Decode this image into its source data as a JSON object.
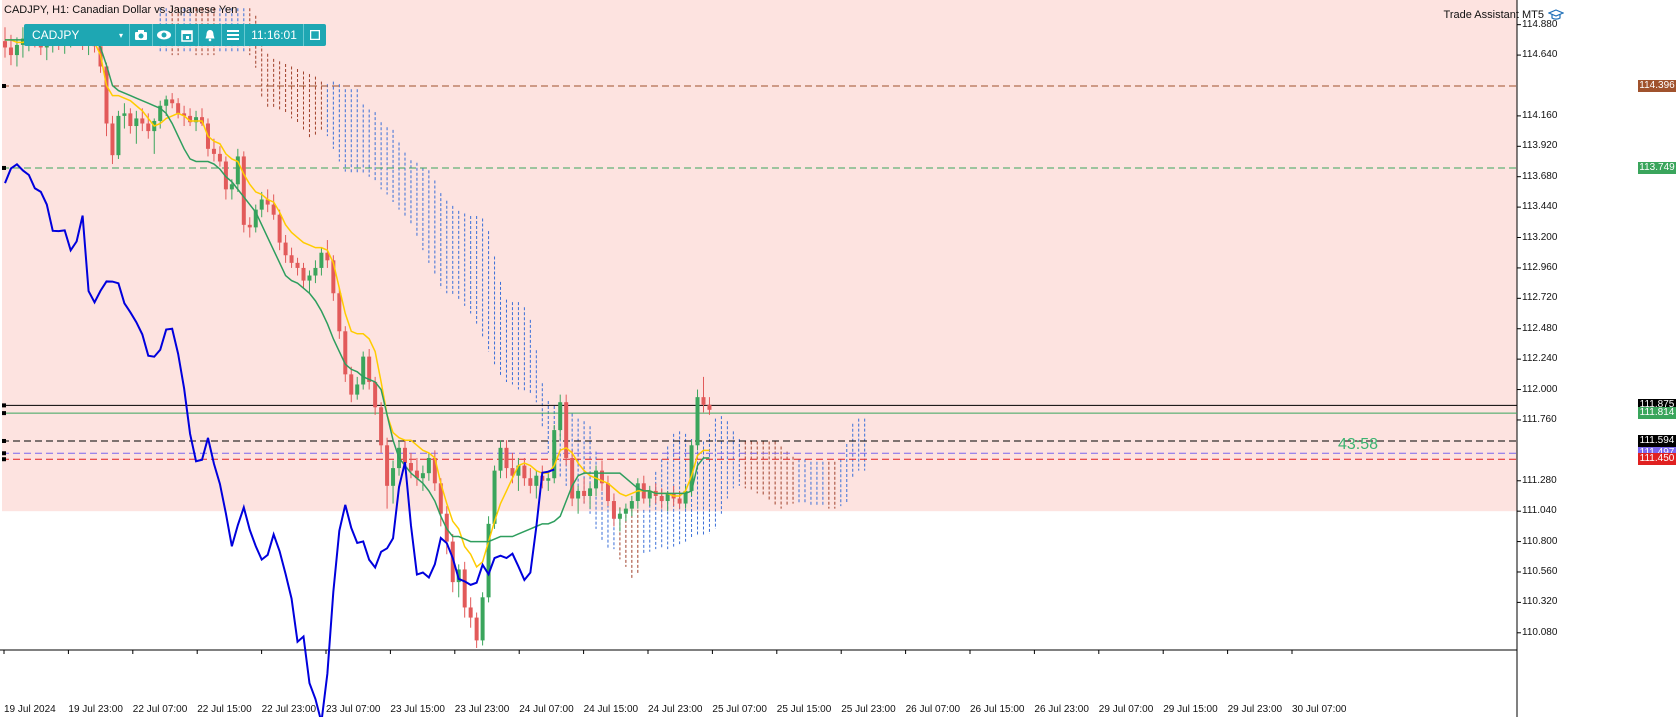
{
  "title": "CADJPY, H1:  Canadian Dollar vs Japanese Yen",
  "toolbar": {
    "symbol": "CADJPY",
    "time": "11:16:01",
    "icons": [
      "camera-icon",
      "eye-icon",
      "calendar-icon",
      "bell-icon",
      "menu-icon",
      "minimize-icon"
    ]
  },
  "assistant_label": "Trade Assistant MT5",
  "countdown": "43:58",
  "price_axis": [
    "114.880",
    "114.640",
    "114.160",
    "113.920",
    "113.680",
    "113.440",
    "113.200",
    "112.960",
    "112.720",
    "112.480",
    "112.240",
    "112.000",
    "111.760",
    "111.280",
    "111.040",
    "110.800",
    "110.560",
    "110.320",
    "110.080"
  ],
  "price_levels": [
    {
      "value": "114.396",
      "color": "#a0522d"
    },
    {
      "value": "113.749",
      "color": "#3aa55c"
    },
    {
      "value": "111.875",
      "color": "#000000"
    },
    {
      "value": "111.814",
      "color": "#3aa55c"
    },
    {
      "value": "111.594",
      "color": "#000000"
    },
    {
      "value": "111.497",
      "color": "#7b68ee"
    },
    {
      "value": "111.450",
      "color": "#e02020"
    }
  ],
  "time_axis": [
    "19 Jul 2024",
    "19 Jul 23:00",
    "22 Jul 07:00",
    "22 Jul 15:00",
    "22 Jul 23:00",
    "23 Jul 07:00",
    "23 Jul 15:00",
    "23 Jul 23:00",
    "24 Jul 07:00",
    "24 Jul 15:00",
    "24 Jul 23:00",
    "25 Jul 07:00",
    "25 Jul 15:00",
    "25 Jul 23:00",
    "26 Jul 07:00",
    "26 Jul 15:00",
    "26 Jul 23:00",
    "29 Jul 07:00",
    "29 Jul 15:00",
    "29 Jul 23:00",
    "30 Jul 07:00"
  ],
  "colors": {
    "bull": "#3aa55c",
    "bear": "#e25a5a",
    "chikou": "#0000dd",
    "tenkan": "#ffcc00",
    "kijun": "#2e9e5e",
    "zone": "#fde3e0"
  },
  "chart_data": {
    "type": "candlestick",
    "symbol": "CADJPY",
    "timeframe": "H1",
    "ylim": [
      109.96,
      114.98
    ],
    "grid": false,
    "candles_ohlc": [
      [
        114.75,
        114.86,
        114.62,
        114.7
      ],
      [
        114.7,
        114.8,
        114.56,
        114.64
      ],
      [
        114.64,
        114.78,
        114.55,
        114.72
      ],
      [
        114.72,
        114.86,
        114.62,
        114.77
      ],
      [
        114.77,
        114.86,
        114.67,
        114.79
      ],
      [
        114.79,
        114.86,
        114.7,
        114.75
      ],
      [
        114.75,
        114.82,
        114.64,
        114.7
      ],
      [
        114.7,
        114.8,
        114.6,
        114.74
      ],
      [
        114.74,
        114.84,
        114.66,
        114.77
      ],
      [
        114.77,
        114.84,
        114.68,
        114.73
      ],
      [
        114.73,
        114.81,
        114.65,
        114.77
      ],
      [
        114.77,
        114.85,
        114.7,
        114.8
      ],
      [
        114.8,
        114.86,
        114.72,
        114.76
      ],
      [
        114.76,
        114.82,
        114.68,
        114.72
      ],
      [
        114.72,
        114.8,
        114.64,
        114.75
      ],
      [
        114.75,
        114.82,
        114.66,
        114.71
      ],
      [
        114.71,
        114.76,
        114.5,
        114.55
      ],
      [
        114.55,
        114.58,
        114.0,
        114.1
      ],
      [
        114.1,
        114.16,
        113.78,
        113.85
      ],
      [
        113.85,
        114.2,
        113.82,
        114.16
      ],
      [
        114.16,
        114.26,
        114.06,
        114.18
      ],
      [
        114.18,
        114.22,
        114.02,
        114.08
      ],
      [
        114.08,
        114.2,
        113.94,
        114.14
      ],
      [
        114.14,
        114.22,
        114.04,
        114.1
      ],
      [
        114.1,
        114.18,
        113.98,
        114.04
      ],
      [
        114.04,
        114.14,
        113.86,
        114.12
      ],
      [
        114.12,
        114.28,
        114.06,
        114.24
      ],
      [
        114.24,
        114.32,
        114.16,
        114.29
      ],
      [
        114.29,
        114.34,
        114.22,
        114.26
      ],
      [
        114.26,
        114.3,
        114.14,
        114.18
      ],
      [
        114.18,
        114.24,
        114.08,
        114.16
      ],
      [
        114.16,
        114.22,
        114.08,
        114.11
      ],
      [
        114.11,
        114.2,
        114.04,
        114.15
      ],
      [
        114.15,
        114.22,
        114.08,
        114.1
      ],
      [
        114.1,
        114.14,
        113.84,
        113.9
      ],
      [
        113.9,
        113.98,
        113.8,
        113.86
      ],
      [
        113.86,
        113.92,
        113.76,
        113.8
      ],
      [
        113.8,
        113.84,
        113.5,
        113.58
      ],
      [
        113.58,
        113.66,
        113.5,
        113.62
      ],
      [
        113.62,
        113.9,
        113.56,
        113.84
      ],
      [
        113.84,
        113.88,
        113.24,
        113.3
      ],
      [
        113.3,
        113.36,
        113.2,
        113.28
      ],
      [
        113.28,
        113.46,
        113.24,
        113.42
      ],
      [
        113.42,
        113.56,
        113.36,
        113.5
      ],
      [
        113.5,
        113.58,
        113.4,
        113.46
      ],
      [
        113.46,
        113.54,
        113.34,
        113.38
      ],
      [
        113.38,
        113.42,
        113.1,
        113.16
      ],
      [
        113.16,
        113.22,
        113.0,
        113.06
      ],
      [
        113.06,
        113.12,
        112.96,
        113.0
      ],
      [
        113.0,
        113.04,
        112.9,
        112.96
      ],
      [
        112.96,
        113.0,
        112.8,
        112.86
      ],
      [
        112.86,
        112.94,
        112.76,
        112.9
      ],
      [
        112.9,
        113.02,
        112.84,
        112.96
      ],
      [
        112.96,
        113.12,
        112.9,
        113.08
      ],
      [
        113.08,
        113.18,
        112.96,
        113.02
      ],
      [
        113.02,
        113.06,
        112.7,
        112.76
      ],
      [
        112.76,
        112.8,
        112.4,
        112.46
      ],
      [
        112.46,
        112.5,
        112.06,
        112.12
      ],
      [
        112.12,
        112.18,
        111.9,
        111.96
      ],
      [
        111.96,
        112.1,
        111.92,
        112.04
      ],
      [
        112.04,
        112.3,
        112.0,
        112.26
      ],
      [
        112.26,
        112.32,
        112.0,
        112.06
      ],
      [
        112.06,
        112.1,
        111.8,
        111.86
      ],
      [
        111.86,
        111.9,
        111.5,
        111.56
      ],
      [
        111.56,
        111.62,
        111.06,
        111.24
      ],
      [
        111.24,
        111.44,
        111.1,
        111.38
      ],
      [
        111.38,
        111.6,
        111.32,
        111.54
      ],
      [
        111.54,
        111.6,
        111.38,
        111.42
      ],
      [
        111.42,
        111.5,
        111.3,
        111.36
      ],
      [
        111.36,
        111.46,
        111.24,
        111.3
      ],
      [
        111.3,
        111.4,
        111.2,
        111.34
      ],
      [
        111.34,
        111.5,
        111.28,
        111.46
      ],
      [
        111.46,
        111.52,
        111.2,
        111.26
      ],
      [
        111.26,
        111.3,
        110.92,
        111.02
      ],
      [
        111.02,
        111.08,
        110.7,
        110.8
      ],
      [
        110.8,
        110.86,
        110.4,
        110.48
      ],
      [
        110.48,
        110.62,
        110.36,
        110.58
      ],
      [
        110.58,
        110.64,
        110.2,
        110.28
      ],
      [
        110.28,
        110.36,
        110.12,
        110.2
      ],
      [
        110.2,
        110.24,
        109.96,
        110.02
      ],
      [
        110.02,
        110.4,
        109.98,
        110.36
      ],
      [
        110.36,
        111.0,
        110.32,
        110.94
      ],
      [
        110.94,
        111.4,
        110.9,
        111.36
      ],
      [
        111.36,
        111.6,
        111.3,
        111.54
      ],
      [
        111.54,
        111.6,
        111.3,
        111.38
      ],
      [
        111.38,
        111.5,
        111.26,
        111.32
      ],
      [
        111.32,
        111.46,
        111.2,
        111.4
      ],
      [
        111.4,
        111.46,
        111.24,
        111.3
      ],
      [
        111.3,
        111.38,
        111.18,
        111.24
      ],
      [
        111.24,
        111.36,
        111.14,
        111.32
      ],
      [
        111.32,
        111.4,
        111.22,
        111.28
      ],
      [
        111.28,
        111.36,
        111.2,
        111.3
      ],
      [
        111.3,
        111.72,
        111.26,
        111.68
      ],
      [
        111.68,
        111.96,
        111.6,
        111.9
      ],
      [
        111.9,
        111.96,
        111.4,
        111.46
      ],
      [
        111.46,
        111.52,
        111.08,
        111.14
      ],
      [
        111.14,
        111.24,
        111.02,
        111.2
      ],
      [
        111.2,
        111.3,
        111.1,
        111.16
      ],
      [
        111.16,
        111.26,
        111.06,
        111.22
      ],
      [
        111.22,
        111.4,
        111.16,
        111.36
      ],
      [
        111.36,
        111.44,
        111.2,
        111.26
      ],
      [
        111.26,
        111.32,
        111.08,
        111.12
      ],
      [
        111.12,
        111.18,
        110.92,
        110.98
      ],
      [
        110.98,
        111.06,
        110.88,
        111.02
      ],
      [
        111.02,
        111.1,
        110.96,
        111.06
      ],
      [
        111.06,
        111.16,
        111.0,
        111.12
      ],
      [
        111.12,
        111.3,
        111.06,
        111.26
      ],
      [
        111.26,
        111.32,
        111.1,
        111.14
      ],
      [
        111.14,
        111.24,
        111.08,
        111.2
      ],
      [
        111.2,
        111.26,
        111.1,
        111.16
      ],
      [
        111.16,
        111.22,
        111.06,
        111.12
      ],
      [
        111.12,
        111.2,
        111.04,
        111.18
      ],
      [
        111.18,
        111.24,
        111.08,
        111.14
      ],
      [
        111.14,
        111.2,
        111.06,
        111.1
      ],
      [
        111.1,
        111.24,
        111.06,
        111.2
      ],
      [
        111.2,
        111.6,
        111.16,
        111.56
      ],
      [
        111.56,
        112.0,
        111.52,
        111.94
      ],
      [
        111.94,
        112.1,
        111.82,
        111.88
      ],
      [
        111.88,
        111.94,
        111.8,
        111.84
      ]
    ],
    "chikou_x_index_offset": -26,
    "tenkan": [
      114.76,
      114.76,
      114.74,
      114.74,
      114.76,
      114.76,
      114.74,
      114.74,
      114.74,
      114.74,
      114.76,
      114.76,
      114.76,
      114.76,
      114.76,
      114.74,
      114.64,
      114.4,
      114.32,
      114.32,
      114.3,
      114.28,
      114.24,
      114.2,
      114.14,
      114.08,
      114.1,
      114.14,
      114.16,
      114.18,
      114.16,
      114.12,
      114.12,
      114.12,
      114.0,
      113.96,
      113.94,
      113.86,
      113.82,
      113.8,
      113.7,
      113.62,
      113.56,
      113.54,
      113.5,
      113.48,
      113.4,
      113.3,
      113.24,
      113.2,
      113.16,
      113.14,
      113.12,
      113.12,
      113.1,
      113.0,
      112.8,
      112.6,
      112.46,
      112.44,
      112.44,
      112.4,
      112.3,
      112.06,
      111.8,
      111.66,
      111.62,
      111.6,
      111.6,
      111.56,
      111.52,
      111.5,
      111.46,
      111.26,
      111.1,
      110.96,
      110.9,
      110.76,
      110.7,
      110.6,
      110.64,
      110.8,
      110.96,
      111.1,
      111.2,
      111.3,
      111.4,
      111.42,
      111.4,
      111.36,
      111.34,
      111.34,
      111.4,
      111.52,
      111.54,
      111.5,
      111.42,
      111.36,
      111.32,
      111.3,
      111.28,
      111.26,
      111.22,
      111.18,
      111.16,
      111.18,
      111.2,
      111.2,
      111.2,
      111.18,
      111.18,
      111.18,
      111.16,
      111.16,
      111.2,
      111.32,
      111.48,
      111.52,
      111.52
    ],
    "kijun": [
      114.76,
      114.76,
      114.76,
      114.76,
      114.76,
      114.76,
      114.76,
      114.76,
      114.76,
      114.76,
      114.76,
      114.76,
      114.76,
      114.76,
      114.76,
      114.76,
      114.7,
      114.56,
      114.4,
      114.36,
      114.34,
      114.32,
      114.3,
      114.28,
      114.26,
      114.24,
      114.22,
      114.18,
      114.1,
      114.0,
      113.9,
      113.82,
      113.8,
      113.8,
      113.8,
      113.78,
      113.74,
      113.68,
      113.64,
      113.58,
      113.52,
      113.46,
      113.4,
      113.3,
      113.2,
      113.1,
      113.0,
      112.9,
      112.86,
      112.84,
      112.8,
      112.76,
      112.7,
      112.62,
      112.52,
      112.4,
      112.3,
      112.2,
      112.16,
      112.14,
      112.1,
      112.08,
      112.06,
      112.0,
      111.8,
      111.6,
      111.46,
      111.4,
      111.34,
      111.3,
      111.26,
      111.2,
      111.12,
      111.0,
      110.9,
      110.84,
      110.84,
      110.82,
      110.8,
      110.8,
      110.8,
      110.8,
      110.82,
      110.84,
      110.84,
      110.84,
      110.86,
      110.88,
      110.9,
      110.92,
      110.94,
      110.94,
      110.96,
      111.0,
      111.12,
      111.24,
      111.32,
      111.34,
      111.34,
      111.34,
      111.34,
      111.34,
      111.34,
      111.34,
      111.3,
      111.26,
      111.22,
      111.2,
      111.2,
      111.18,
      111.18,
      111.18,
      111.18,
      111.18,
      111.18,
      111.2,
      111.4,
      111.46,
      111.46
    ]
  }
}
